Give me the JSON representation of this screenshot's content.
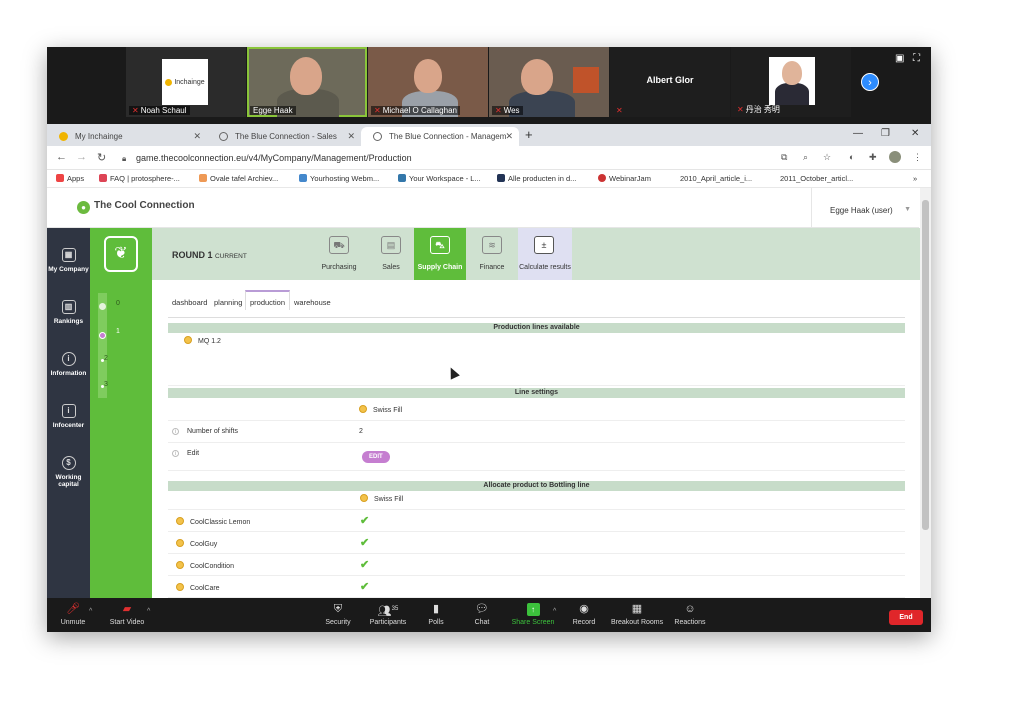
{
  "participants": [
    {
      "name": "Noah Schaul",
      "logo": "Inchainge"
    },
    {
      "name": "Egge Haak"
    },
    {
      "name": "Michael O Callaghan"
    },
    {
      "name": "Wes"
    },
    {
      "name": "Albert Glor"
    },
    {
      "name": "丹治 秀明"
    }
  ],
  "browser": {
    "tabs": [
      {
        "label": "My Inchainge"
      },
      {
        "label": "The Blue Connection - Sales"
      },
      {
        "label": "The Blue Connection - Managem"
      }
    ],
    "url": "game.thecoolconnection.eu/v4/MyCompany/Management/Production",
    "bookmarks": [
      "Apps",
      "FAQ | protosphere-...",
      "Ovale tafel Archiev...",
      "Yourhosting Webm...",
      "Your Workspace - L...",
      "Alle producten in d...",
      "WebinarJam",
      "2010_April_article_i...",
      "2011_October_articl..."
    ]
  },
  "app": {
    "brand": "The Cool Connection",
    "user": "Egge Haak (user)",
    "sidebar": [
      {
        "label": "My Company"
      },
      {
        "label": "Rankings"
      },
      {
        "label": "Information"
      },
      {
        "label": "Infocenter"
      },
      {
        "label": "Working capital"
      }
    ],
    "rounds": [
      "0",
      "1",
      "2",
      "3"
    ],
    "round_title": "ROUND 1",
    "round_status": "CURRENT",
    "nav": [
      {
        "label": "Purchasing"
      },
      {
        "label": "Sales"
      },
      {
        "label": "Supply Chain"
      },
      {
        "label": "Finance"
      },
      {
        "label": "Calculate results"
      }
    ],
    "subtabs": [
      "dashboard",
      "planning",
      "production",
      "warehouse"
    ],
    "sections": {
      "lines_available": "Production lines available",
      "line_settings": "Line settings",
      "allocate": "Allocate product to Bottling line"
    },
    "lines": [
      "MQ 1.2"
    ],
    "line_name": "Swiss Fill",
    "settings": {
      "shifts_label": "Number of shifts",
      "shifts_value": "2",
      "edit_label": "Edit",
      "edit_button": "EDIT"
    },
    "allocate_line": "Swiss Fill",
    "products": [
      "CoolClassic Lemon",
      "CoolGuy",
      "CoolCondition",
      "CoolCare"
    ]
  },
  "toolbar": {
    "unmute": "Unmute",
    "start_video": "Start Video",
    "security": "Security",
    "participants": "Participants",
    "participants_count": "35",
    "polls": "Polls",
    "chat": "Chat",
    "share": "Share Screen",
    "record": "Record",
    "breakout": "Breakout Rooms",
    "reactions": "Reactions",
    "end": "End"
  },
  "colors": {
    "accent_green": "#5fbd3b",
    "nav_bg": "#cfe1d0",
    "sidebar_dark": "#2f3542",
    "edit_purple": "#c57ed0",
    "end_red": "#e0262a"
  }
}
